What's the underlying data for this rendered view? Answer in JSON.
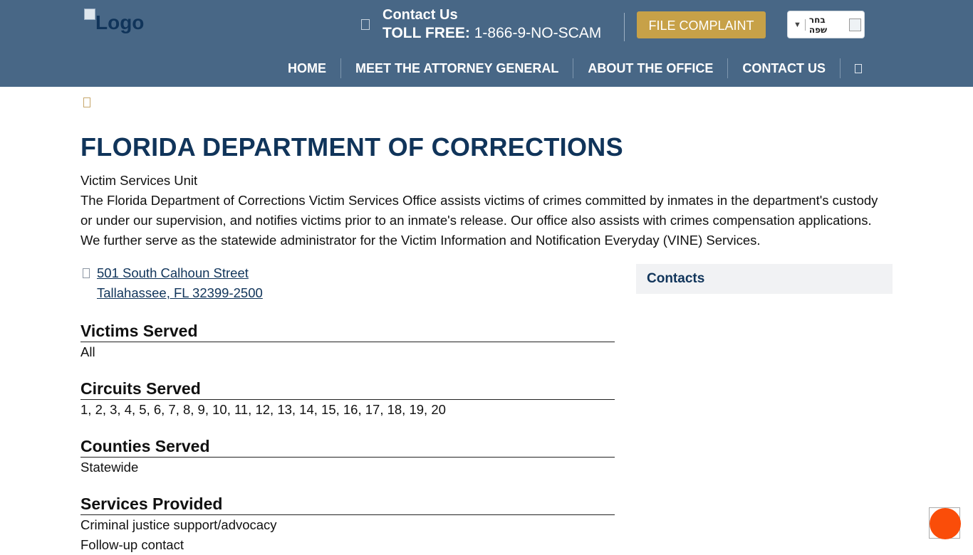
{
  "header": {
    "logo_alt": "Logo",
    "contact_title": "Contact Us",
    "toll_label": "TOLL FREE:",
    "toll_number": "1-866-9-NO-SCAM",
    "file_complaint": "FILE COMPLAINT",
    "language_select": "בחר שפה",
    "language_arrow": "▼",
    "nav": [
      "HOME",
      "MEET THE ATTORNEY GENERAL",
      "ABOUT THE OFFICE",
      "CONTACT US"
    ]
  },
  "page": {
    "title": "FLORIDA DEPARTMENT OF CORRECTIONS",
    "subtitle": "Victim Services Unit",
    "description": "The Florida Department of Corrections Victim Services Office assists victims of crimes committed by inmates in the department's custody or under our supervision, and notifies victims prior to an inmate's release. Our office also assists with crimes compensation applications. We further serve as the statewide administrator for the Victim Information and Notification Everyday (VINE) Services.",
    "address_line1": "501 South Calhoun Street",
    "address_line2": "Tallahassee, FL 32399-2500"
  },
  "sections": {
    "victims": {
      "heading": "Victims Served",
      "value": "All"
    },
    "circuits": {
      "heading": "Circuits Served",
      "value": "1, 2, 3, 4, 5, 6, 7, 8, 9, 10, 11, 12, 13, 14, 15, 16, 17, 18, 19, 20"
    },
    "counties": {
      "heading": "Counties Served",
      "value": "Statewide"
    },
    "services": {
      "heading": "Services Provided",
      "values": [
        "Criminal justice support/advocacy",
        "Follow-up contact"
      ]
    }
  },
  "sidebar": {
    "contacts_heading": "Contacts"
  },
  "colors": {
    "header_bg": "#486786",
    "brand_navy": "#10345a",
    "button_gold": "#c7a148",
    "chat_orange": "#fa4d09"
  },
  "icons": {
    "phone": "phone-icon",
    "search": "search-icon",
    "breadcrumb": "home-icon",
    "location": "map-marker-icon",
    "chat": "chat-icon"
  }
}
